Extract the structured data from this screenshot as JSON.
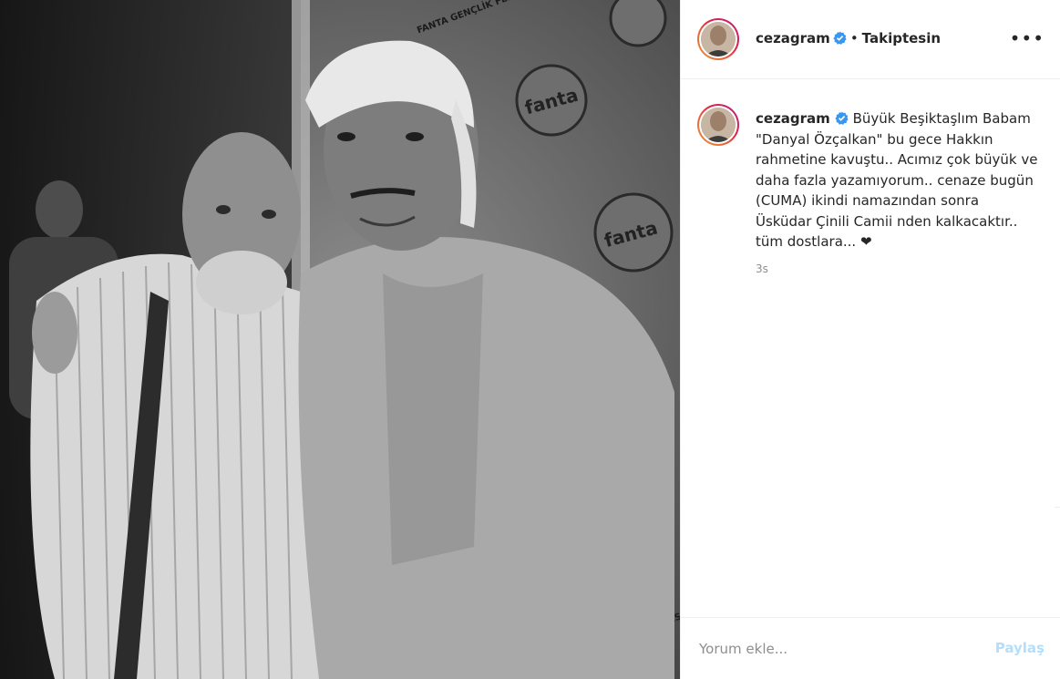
{
  "post": {
    "image_alt": "Black and white photo of two men",
    "backdrop_logo_texts": [
      "fanta",
      "FANTA GENÇLİK FESTİVALİ"
    ]
  },
  "header": {
    "username": "cezagram",
    "separator": "•",
    "follow_status": "Takiptesin",
    "more_label": "•••",
    "verified_icon": "verified-badge-icon",
    "verified_color": "#3897f0"
  },
  "caption": {
    "username": "cezagram",
    "text": "Büyük Beşiktaşlım Babam \"Danyal Özçalkan\" bu gece Hakkın rahmetine kavuştu.. Acımız çok büyük ve daha fazla yazamıyorum.. cenaze bugün (CUMA) ikindi namazından sonra Üsküdar Çinili Camii nden kalkacaktır.. tüm dostlara... ❤",
    "timestamp": "3s"
  },
  "comment": {
    "placeholder": "Yorum ekle...",
    "share_label": "Paylaş"
  },
  "colors": {
    "accent": "#3897f0",
    "share_disabled": "#b2dffc",
    "muted": "#8e8e8e",
    "text": "#262626"
  }
}
